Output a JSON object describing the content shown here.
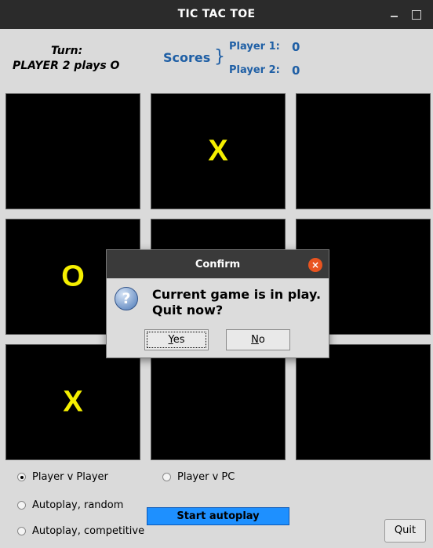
{
  "window": {
    "title": "TIC TAC TOE"
  },
  "turn": {
    "label": "Turn:",
    "status": "PLAYER 2 plays O"
  },
  "scores": {
    "label": "Scores",
    "brace": "}",
    "players": [
      {
        "label": "Player 1:",
        "score": "0"
      },
      {
        "label": "Player 2:",
        "score": "0"
      }
    ]
  },
  "board": {
    "mark_color": "#f5ef00",
    "cells": [
      "",
      "X",
      "",
      "O",
      "",
      "",
      "X",
      "",
      ""
    ]
  },
  "modes": {
    "player_v_player": "Player v Player",
    "player_v_pc": "Player v PC",
    "autoplay_random": "Autoplay, random",
    "autoplay_competitive": "Autoplay, competitive",
    "selected": "Player v Player"
  },
  "buttons": {
    "start_autoplay": "Start autoplay",
    "quit": "Quit"
  },
  "dialog": {
    "title": "Confirm",
    "close": "×",
    "icon": "?",
    "message_line1": "Current game is in play.",
    "message_line2": "Quit now?",
    "yes": "Yes",
    "no": "No",
    "yes_mnemonic": "Y",
    "yes_rest": "es",
    "no_mnemonic": "N",
    "no_rest": "o"
  },
  "colors": {
    "accent": "#1f5fa5",
    "start_button": "#1e90ff",
    "board": "#000000"
  }
}
